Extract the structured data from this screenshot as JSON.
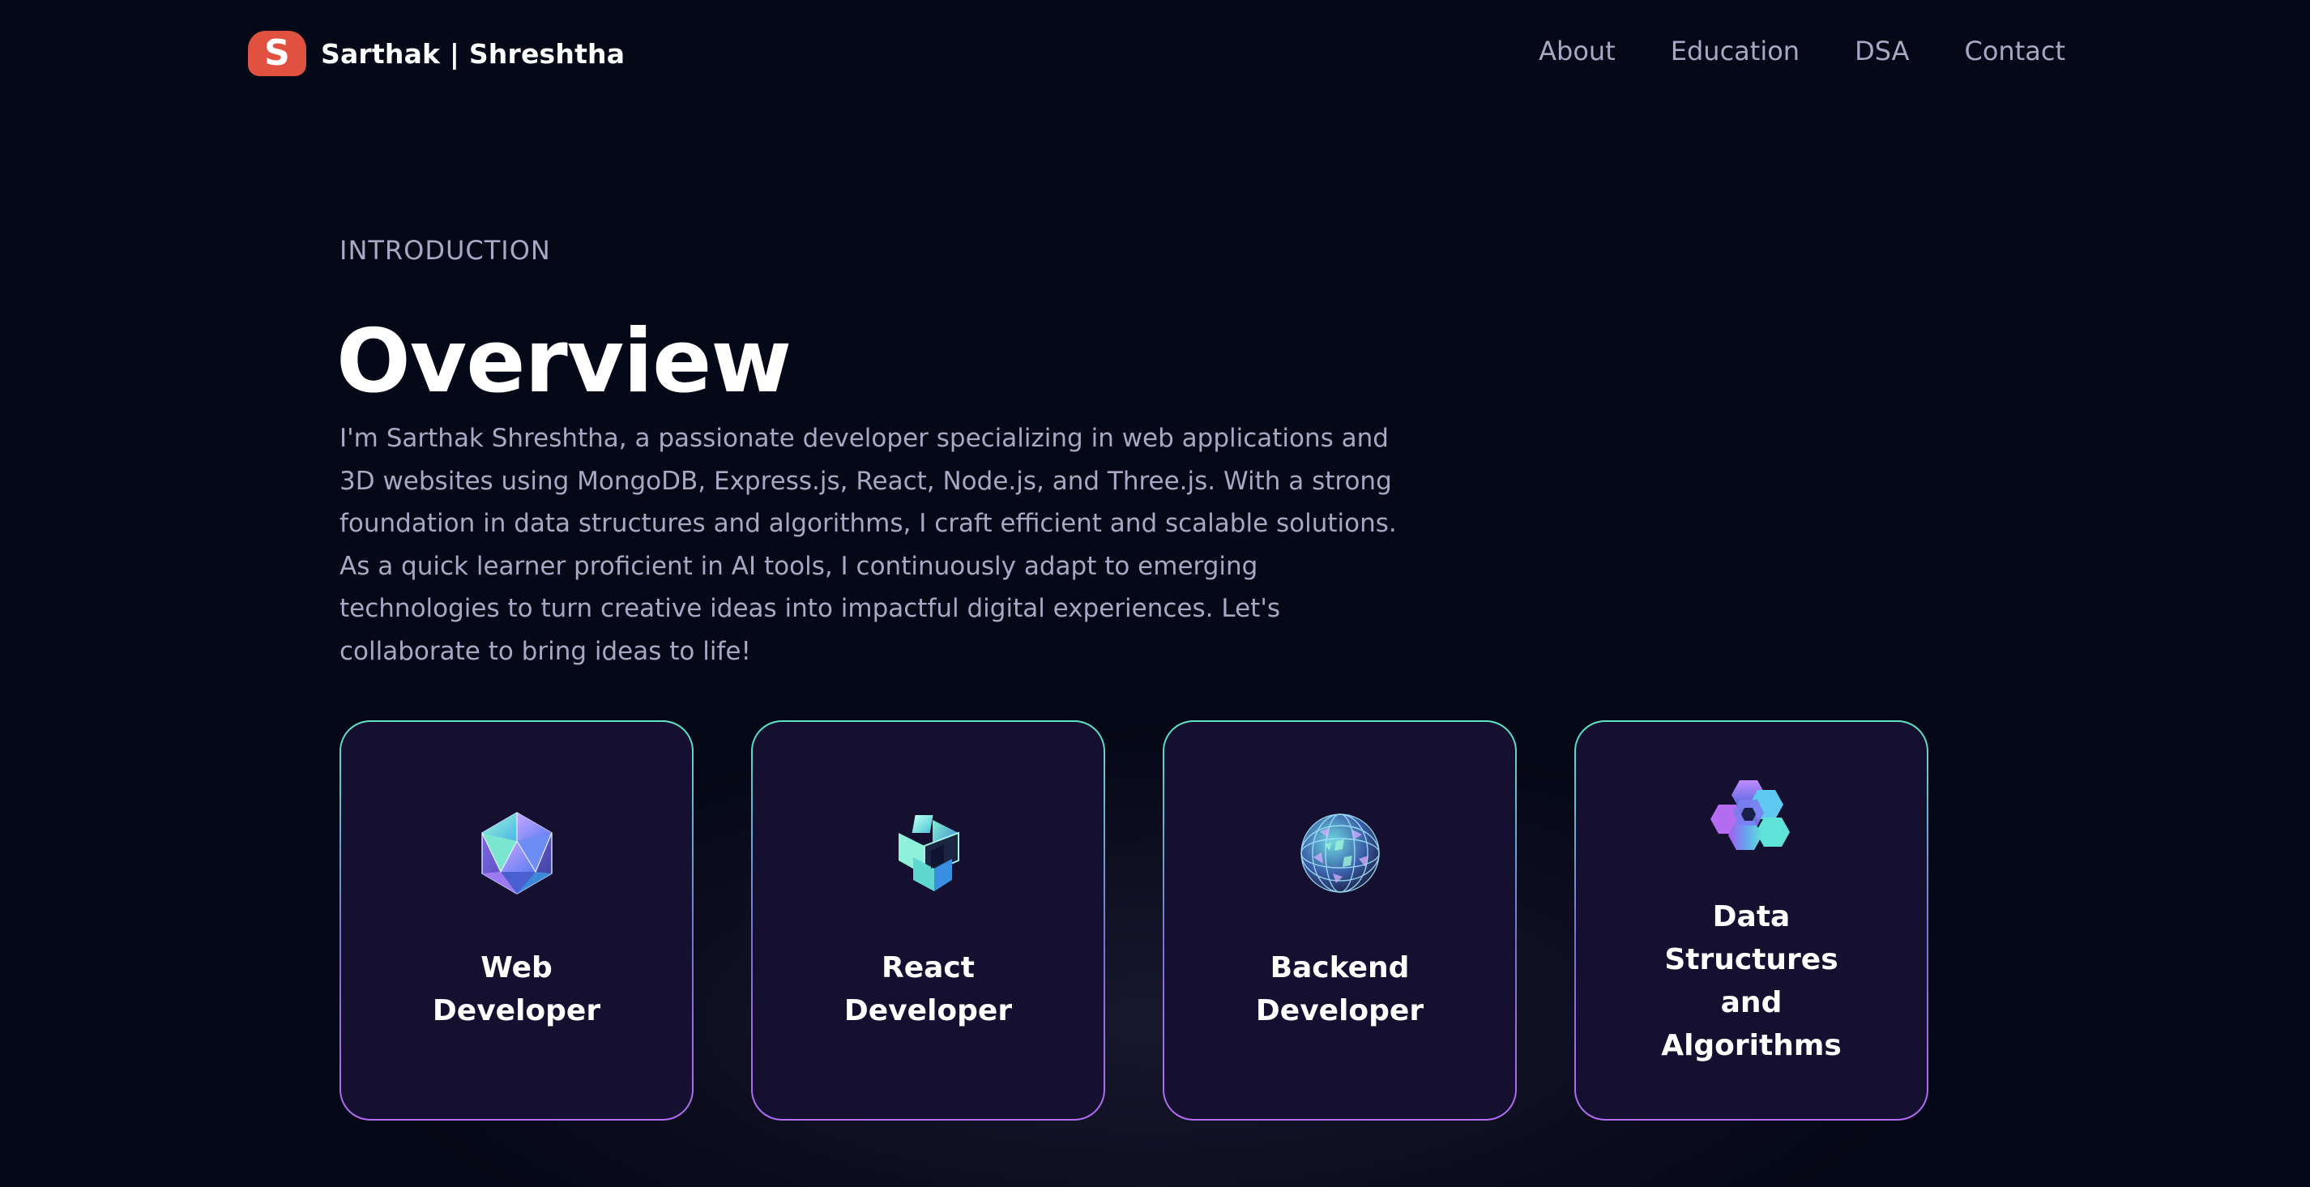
{
  "navbar": {
    "logo_letter": "S",
    "logo_text": "Sarthak | Shreshtha",
    "links": [
      {
        "label": "About"
      },
      {
        "label": "Education"
      },
      {
        "label": "DSA"
      },
      {
        "label": "Contact"
      }
    ]
  },
  "hero": {
    "eyebrow": "INTRODUCTION",
    "title": "Overview",
    "description": "I'm Sarthak Shreshtha, a passionate developer specializing in web applications and 3D websites using MongoDB, Express.js, React, Node.js, and Three.js. With a strong foundation in data structures and algorithms, I craft efficient and scalable solutions. As a quick learner proficient in AI tools, I continuously adapt to emerging technologies to turn creative ideas into impactful digital experiences. Let's collaborate to bring ideas to life!"
  },
  "services": [
    {
      "title": "Web Developer",
      "icon": "icosahedron-icon"
    },
    {
      "title": "React Developer",
      "icon": "crystal-cube-icon"
    },
    {
      "title": "Backend Developer",
      "icon": "geodesic-sphere-icon"
    },
    {
      "title": "Data Structures and Algorithms",
      "icon": "hexagon-cluster-icon"
    }
  ],
  "colors": {
    "background": "#050816",
    "card": "#151030",
    "secondary_text": "#aaa6c3",
    "logo_accent": "#e0523f",
    "border_top": "#5fe3c6",
    "border_bottom": "#b46cf0"
  }
}
